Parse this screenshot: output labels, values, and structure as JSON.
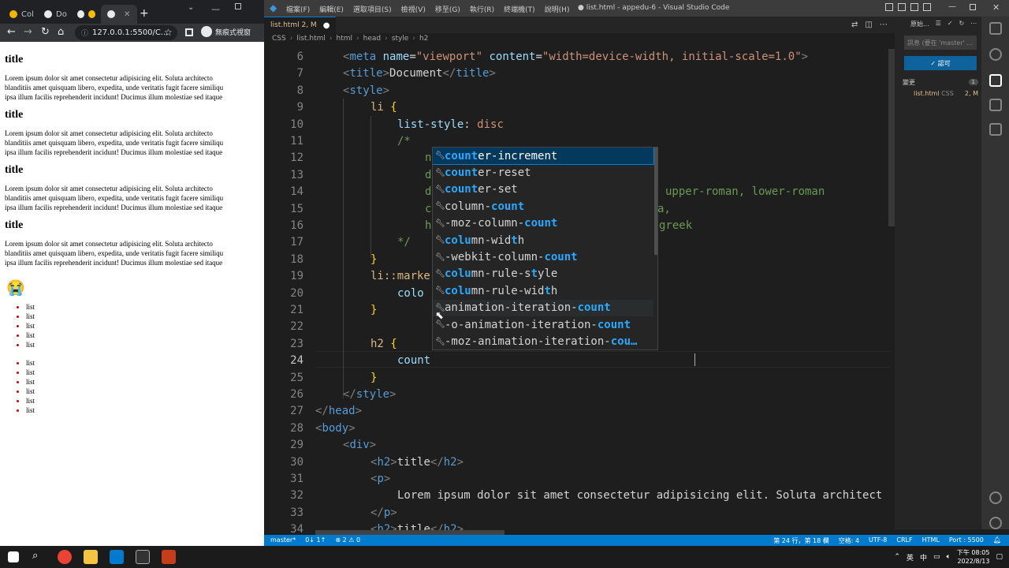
{
  "chrome": {
    "tabs": [
      {
        "label": "Col"
      },
      {
        "label": "Do"
      },
      {
        "label": ""
      },
      {
        "label": ""
      }
    ],
    "url": "127.0.0.1:5500/C...",
    "incognito_label": "無痕式視窗",
    "page": {
      "sections": [
        {
          "heading": "title",
          "p1": "Lorem ipsum dolor sit amet consectetur adipisicing elit. Soluta architecto",
          "p2": "blanditiis amet quisquam libero, expedita, unde veritatis fugit facere similiqu",
          "p3": "ipsa illum facilis reprehenderit incidunt! Ducimus illum molestiae sed itaque"
        },
        {
          "heading": "title",
          "p1": "Lorem ipsum dolor sit amet consectetur adipisicing elit. Soluta architecto",
          "p2": "blanditiis amet quisquam libero, expedita, unde veritatis fugit facere similiqu",
          "p3": "ipsa illum facilis reprehenderit incidunt! Ducimus illum molestiae sed itaque"
        },
        {
          "heading": "title",
          "p1": "Lorem ipsum dolor sit amet consectetur adipisicing elit. Soluta architecto",
          "p2": "blanditiis amet quisquam libero, expedita, unde veritatis fugit facere similiqu",
          "p3": "ipsa illum facilis reprehenderit incidunt! Ducimus illum molestiae sed itaque"
        },
        {
          "heading": "title",
          "p1": "Lorem ipsum dolor sit amet consectetur adipisicing elit. Soluta architecto",
          "p2": "blanditiis amet quisquam libero, expedita, unde veritatis fugit facere similiqu",
          "p3": "ipsa illum facilis reprehenderit incidunt! Ducimus illum molestiae sed itaque"
        }
      ],
      "emoji": "😭",
      "list_a": [
        "list",
        "list",
        "list",
        "list",
        "list"
      ],
      "list_b": [
        "list",
        "list",
        "list",
        "list",
        "list",
        "list"
      ]
    }
  },
  "vscode": {
    "menus": [
      "檔案(F)",
      "編輯(E)",
      "選取項目(S)",
      "檢視(V)",
      "移至(G)",
      "執行(R)",
      "終端機(T)",
      "說明(H)"
    ],
    "window_title": "● list.html - appedu-6 - Visual Studio Code",
    "tab": {
      "label": "list.html",
      "status": "2, M"
    },
    "breadcrumb": [
      "CSS",
      "list.html",
      "html",
      "head",
      "style",
      "h2"
    ],
    "line_numbers": [
      6,
      7,
      8,
      9,
      10,
      11,
      12,
      13,
      14,
      15,
      16,
      17,
      18,
      19,
      20,
      21,
      22,
      23,
      24,
      25,
      26,
      27,
      28,
      29,
      30,
      31,
      32,
      33,
      34
    ],
    "code": {
      "l6a": "<",
      "l6b": "meta",
      "l6c": " name",
      "l6d": "=",
      "l6e": "\"viewport\"",
      "l6f": " content",
      "l6g": "=",
      "l6h": "\"width=device-width, initial-scale=1.0\"",
      "l6i": ">",
      "l7a": "<",
      "l7b": "title",
      "l7c": ">",
      "l7d": "Document",
      "l7e": "</",
      "l7f": "title",
      "l7g": ">",
      "l8a": "<",
      "l8b": "style",
      "l8c": ">",
      "l9a": "li",
      "l9b": " {",
      "l10a": "list-style",
      "l10b": ": ",
      "l10c": "disc",
      "l11": "/*",
      "l12": "n",
      "l13": "d",
      "l14a": "d",
      "l14b": "upper-roman, lower-roman",
      "l15a": "c",
      "l15b": "a,",
      "l16a": "h",
      "l16b": "greek",
      "l17": "*/",
      "l18": "}",
      "l19": "li::marke",
      "l20": "colo",
      "l21": "}",
      "l23a": "h2",
      "l23b": " {",
      "l24": "count",
      "l25": "}",
      "l26a": "</",
      "l26b": "style",
      "l26c": ">",
      "l27a": "</",
      "l27b": "head",
      "l27c": ">",
      "l28a": "<",
      "l28b": "body",
      "l28c": ">",
      "l29a": "<",
      "l29b": "div",
      "l29c": ">",
      "l30a": "<",
      "l30b": "h2",
      "l30c": ">",
      "l30d": "title",
      "l30e": "</",
      "l30f": "h2",
      "l30g": ">",
      "l31a": "<",
      "l31b": "p",
      "l31c": ">",
      "l32": "Lorem ipsum dolor sit amet consectetur adipisicing elit. Soluta architect",
      "l33a": "</",
      "l33b": "p",
      "l33c": ">",
      "l34a": "<",
      "l34b": "h2",
      "l34c": ">",
      "l34d": "title",
      "l34e": "</",
      "l34f": "h2",
      "l34g": ">"
    },
    "suggestions": [
      {
        "m1": "count",
        "r1": "er-increment"
      },
      {
        "m1": "count",
        "r1": "er-reset"
      },
      {
        "m1": "count",
        "r1": "er-set"
      },
      {
        "p0": "column-",
        "m1": "count"
      },
      {
        "p0": "-moz-column-",
        "m1": "count"
      },
      {
        "m1": "colu",
        "r1": "mn-wid",
        "m2": "t",
        "r2": "h"
      },
      {
        "p0": "-webkit-column-",
        "m1": "count"
      },
      {
        "m1": "colu",
        "r1": "mn-rule-s",
        "m2": "t",
        "r2": "yle"
      },
      {
        "m1": "colu",
        "r1": "mn-rule-wid",
        "m2": "t",
        "r2": "h"
      },
      {
        "p0": "animation-iteration-",
        "m1": "count"
      },
      {
        "p0": "-o-animation-iteration-",
        "m1": "count"
      },
      {
        "p0": "-moz-animation-iteration-",
        "m1": "cou…"
      }
    ],
    "scm": {
      "header": [
        "原始...",
        "⋯"
      ],
      "message_placeholder": "訊息 (要在 'master' ...",
      "commit_label": "✓ 認可",
      "changes_label": "變更",
      "changes_count": "1",
      "file": "list.html",
      "file_lang": "CSS",
      "file_status": "2, M"
    },
    "status": {
      "branch": "master*",
      "sync": "0↓ 1↑",
      "problems": "⊗ 2 ⚠ 0",
      "position": "第 24 行，第 18 欄",
      "spaces": "空格: 4",
      "encoding": "UTF-8",
      "eol": "CRLF",
      "language": "HTML",
      "port": "Port : 5500"
    }
  },
  "taskbar": {
    "lang1": "英",
    "lang2": "中",
    "time": "下午 08:05",
    "date": "2022/8/13"
  }
}
